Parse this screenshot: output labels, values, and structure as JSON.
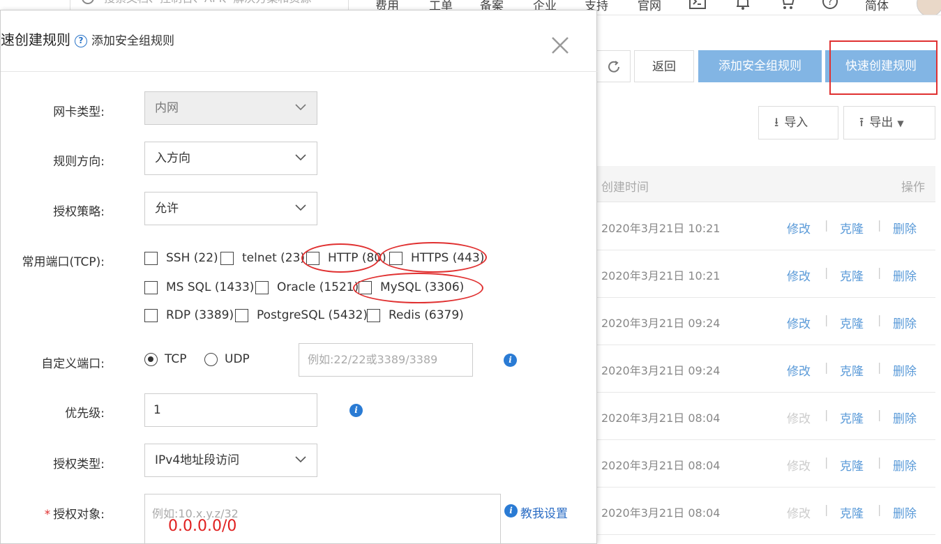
{
  "topnav": {
    "search_placeholder": "搜索文档、控制台、API、解决方案和资源",
    "items": [
      "费用",
      "工单",
      "备案",
      "企业",
      "支持",
      "官网"
    ],
    "lang": "简体"
  },
  "toolbar": {
    "back_label": "返回",
    "add_rule_label": "添加安全组规则",
    "quick_create_label": "快速创建规则",
    "import_label": "导入",
    "export_label": "导出"
  },
  "table": {
    "headers": {
      "created": "创建时间",
      "actions": "操作"
    },
    "rows": [
      {
        "time": "2020年3月21日 10:21",
        "edit": "修改",
        "clone": "克隆",
        "delete": "删除",
        "edit_disabled": false
      },
      {
        "time": "2020年3月21日 10:21",
        "edit": "修改",
        "clone": "克隆",
        "delete": "删除",
        "edit_disabled": false
      },
      {
        "time": "2020年3月21日 09:24",
        "edit": "修改",
        "clone": "克隆",
        "delete": "删除",
        "edit_disabled": false
      },
      {
        "time": "2020年3月21日 09:24",
        "edit": "修改",
        "clone": "克隆",
        "delete": "删除",
        "edit_disabled": false
      },
      {
        "time": "2020年3月21日 08:04",
        "edit": "修改",
        "clone": "克隆",
        "delete": "删除",
        "edit_disabled": true
      },
      {
        "time": "2020年3月21日 08:04",
        "edit": "修改",
        "clone": "克隆",
        "delete": "删除",
        "edit_disabled": true
      },
      {
        "time": "2020年3月21日 08:04",
        "edit": "修改",
        "clone": "克隆",
        "delete": "删除",
        "edit_disabled": true
      }
    ]
  },
  "modal": {
    "title": "速创建规则",
    "subtitle": "添加安全组规则",
    "help_icon": "?",
    "nic_type_label": "网卡类型:",
    "nic_type_value": "内网",
    "direction_label": "规则方向:",
    "direction_value": "入方向",
    "policy_label": "授权策略:",
    "policy_value": "允许",
    "ports_label": "常用端口(TCP):",
    "ports": {
      "ssh": "SSH (22)",
      "telnet": "telnet (23)",
      "http": "HTTP (80)",
      "https": "HTTPS (443)",
      "mssql": "MS SQL (1433)",
      "oracle": "Oracle (1521)",
      "mysql": "MySQL (3306)",
      "rdp": "RDP (3389)",
      "postgresql": "PostgreSQL (5432)",
      "redis": "Redis (6379)"
    },
    "custom_port_label": "自定义端口:",
    "proto_tcp": "TCP",
    "proto_udp": "UDP",
    "custom_port_placeholder": "例如:22/22或3389/3389",
    "priority_label": "优先级:",
    "priority_value": "1",
    "auth_type_label": "授权类型:",
    "auth_type_value": "IPv4地址段访问",
    "required_mark": "*",
    "auth_object_label": "授权对象:",
    "auth_object_placeholder": "例如:10.x.y.z/32",
    "auth_object_annotation": "0.0.0.0/0",
    "teach_link": "教我设置",
    "info_icon": "i"
  },
  "colors": {
    "accent": "#2a7bd4",
    "button_blue": "#82b5e4",
    "annotation_red": "#e03030",
    "link": "#5a9ad8"
  }
}
